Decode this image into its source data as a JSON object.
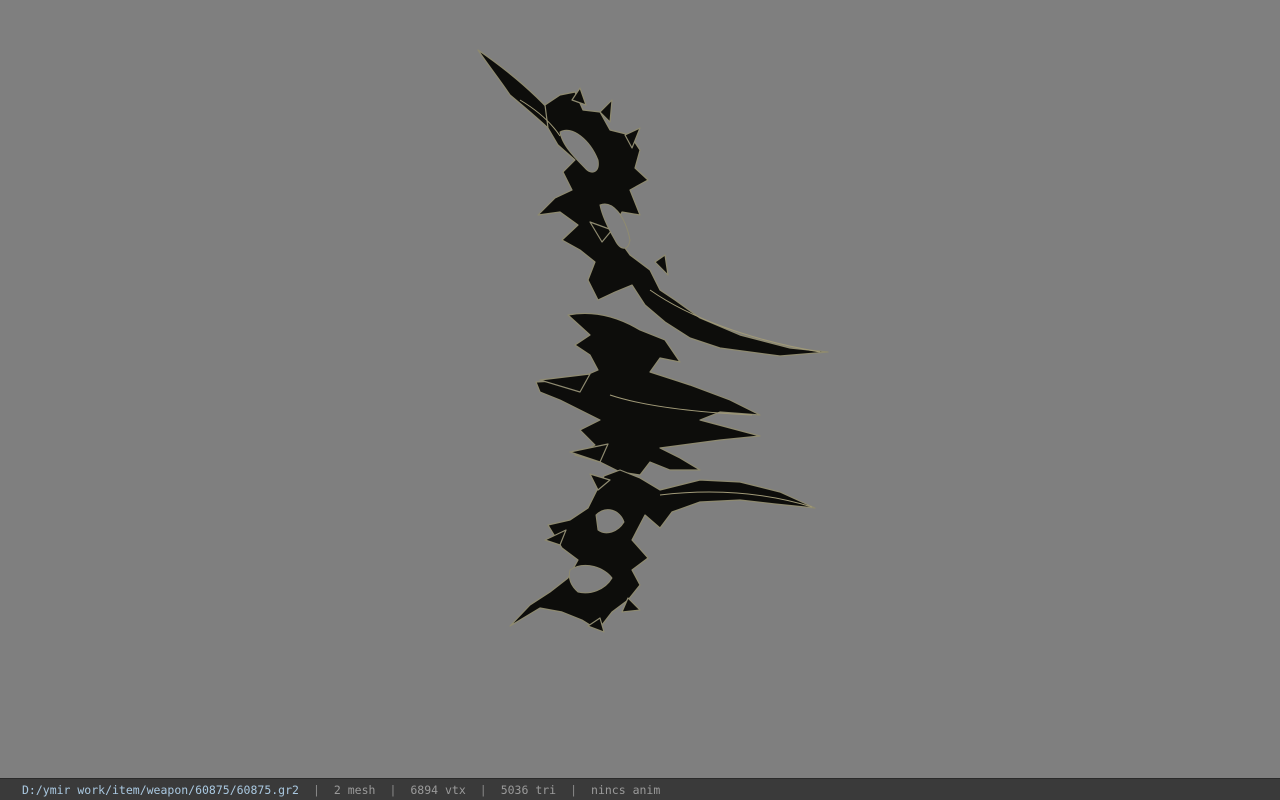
{
  "status_bar": {
    "file_path": "D:/ymir work/item/weapon/60875/60875.gr2",
    "separator": "|",
    "mesh_count": "2 mesh",
    "vertex_count": "6894 vtx",
    "triangle_count": "5036 tri",
    "anim_status": "nincs anim"
  },
  "viewport": {
    "background_color": "#7f7f7f",
    "model_fill": "#0d0d0b",
    "model_edge": "#8e8a70",
    "model_object": "bow-model"
  }
}
